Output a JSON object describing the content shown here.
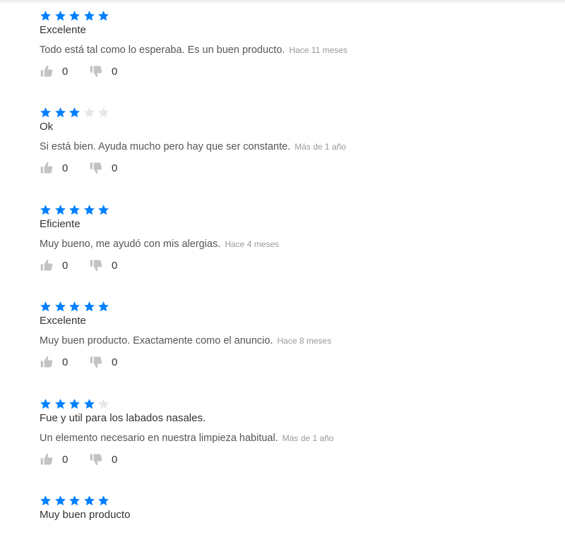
{
  "colors": {
    "star_filled": "#0080ff",
    "star_empty": "#e6e6e6",
    "thumb_icon": "#c3c3c3"
  },
  "reviews": [
    {
      "rating": 5,
      "title": "Excelente",
      "body": "Todo está tal como lo esperaba. Es un buen producto.",
      "date": "Hace 11 meses",
      "likes": "0",
      "dislikes": "0"
    },
    {
      "rating": 3,
      "title": "Ok",
      "body": "Si está bien. Ayuda mucho pero hay que ser constante.",
      "date": "Más de 1 año",
      "likes": "0",
      "dislikes": "0"
    },
    {
      "rating": 5,
      "title": "Eficiente",
      "body": "Muy bueno, me ayudó con mis alergias.",
      "date": "Hace 4 meses",
      "likes": "0",
      "dislikes": "0"
    },
    {
      "rating": 5,
      "title": "Excelente",
      "body": "Muy buen producto. Exactamente como el anuncio.",
      "date": "Hace 8 meses",
      "likes": "0",
      "dislikes": "0"
    },
    {
      "rating": 4,
      "title": "Fue y util para los labados nasales.",
      "body": "Un elemento necesario en nuestra limpieza habitual.",
      "date": "Más de 1 año",
      "likes": "0",
      "dislikes": "0"
    },
    {
      "rating": 5,
      "title": "Muy buen producto"
    }
  ]
}
